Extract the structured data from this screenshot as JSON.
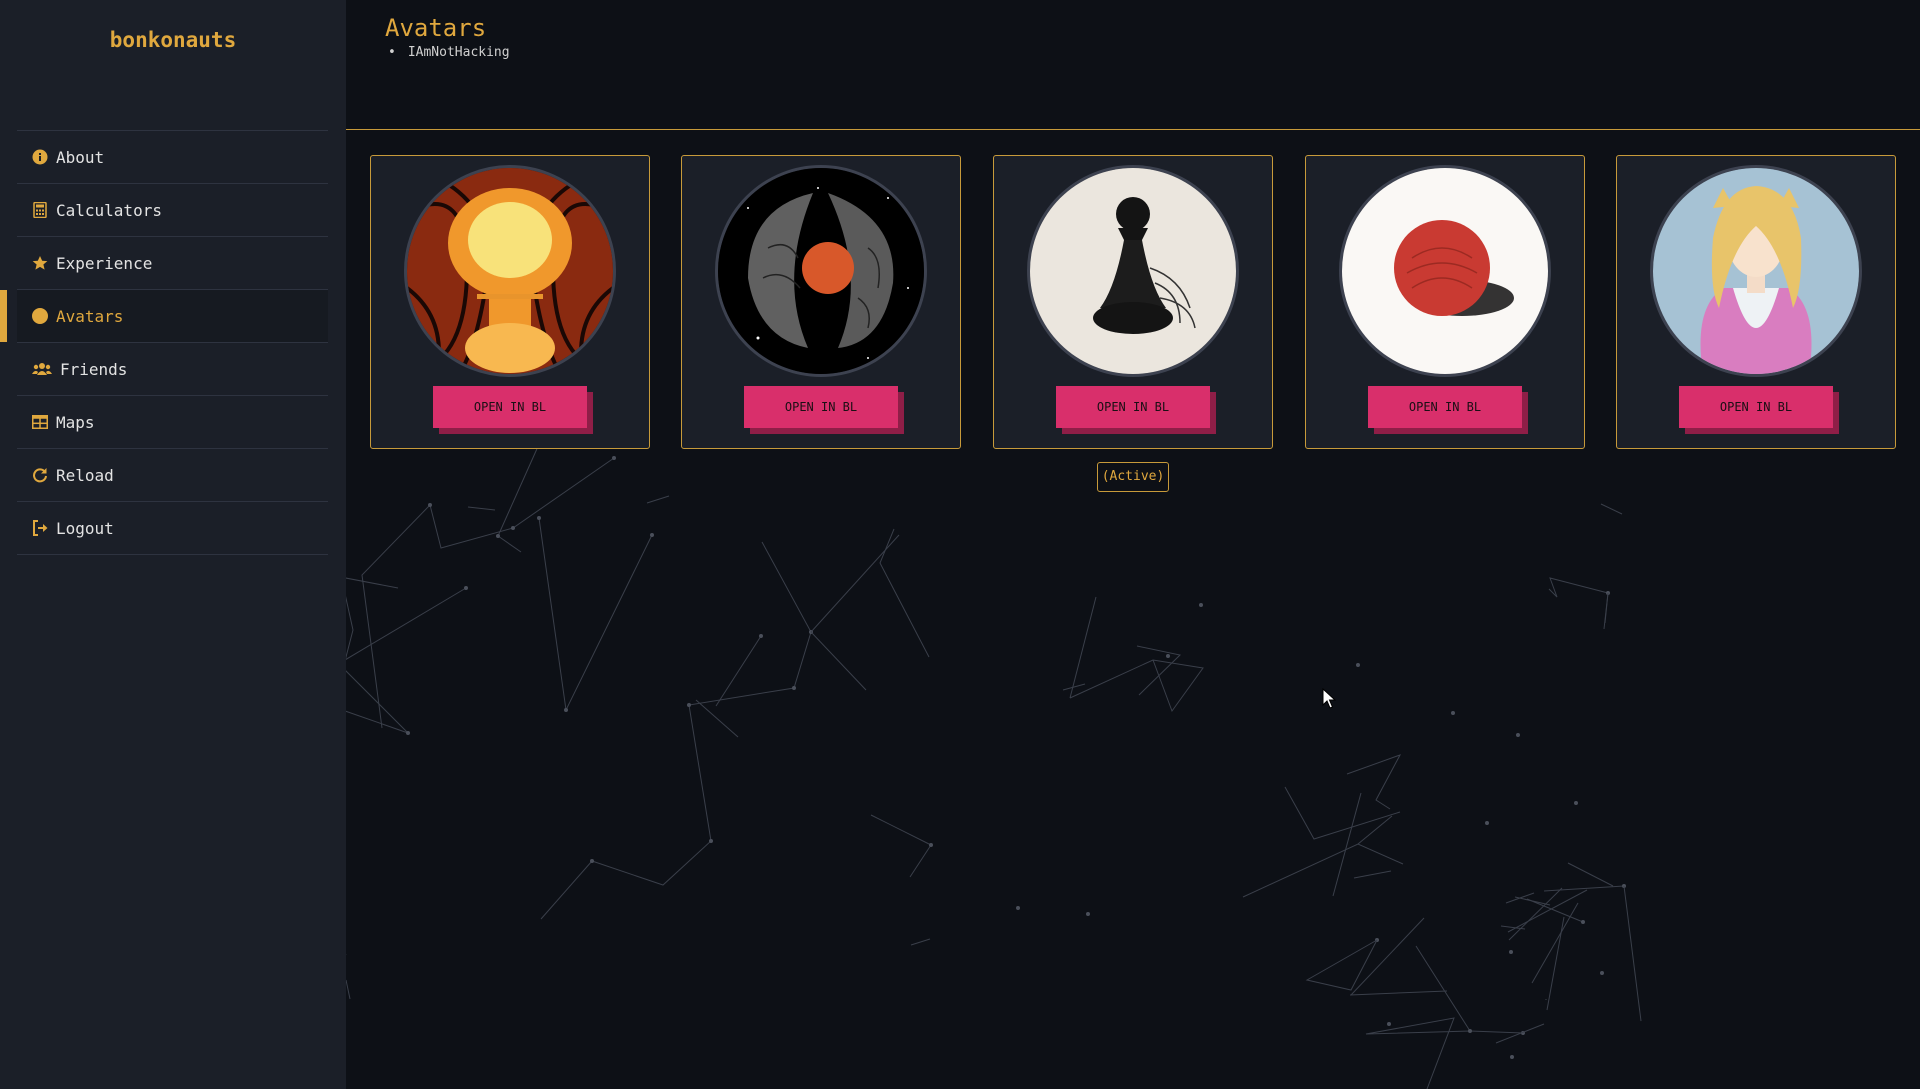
{
  "app": {
    "brand": "bonkonauts"
  },
  "sidebar": {
    "items": [
      {
        "label": "About",
        "icon": "info-icon"
      },
      {
        "label": "Calculators",
        "icon": "calculator-icon"
      },
      {
        "label": "Experience",
        "icon": "star-icon"
      },
      {
        "label": "Avatars",
        "icon": "user-circle-icon",
        "active": true
      },
      {
        "label": "Friends",
        "icon": "users-icon"
      },
      {
        "label": "Maps",
        "icon": "table-icon"
      },
      {
        "label": "Reload",
        "icon": "refresh-icon"
      },
      {
        "label": "Logout",
        "icon": "logout-icon"
      }
    ]
  },
  "header": {
    "title": "Avatars",
    "users": [
      "IAmNotHacking"
    ]
  },
  "avatars": [
    {
      "button_label": "OPEN IN BL",
      "image": "mushroom-cloud-fingerprint"
    },
    {
      "button_label": "OPEN IN BL",
      "image": "planet-core-fingerprint"
    },
    {
      "button_label": "OPEN IN BL",
      "image": "chess-pawn-fingerprint",
      "active": true
    },
    {
      "button_label": "OPEN IN BL",
      "image": "red-sphere-fingerprint"
    },
    {
      "button_label": "OPEN IN BL",
      "image": "blonde-anime-character"
    }
  ],
  "active_label": "(Active)",
  "colors": {
    "accent": "#e0a83e",
    "button": "#d92f6b",
    "sidebar": "#1b1f28",
    "background": "#0d1016"
  }
}
